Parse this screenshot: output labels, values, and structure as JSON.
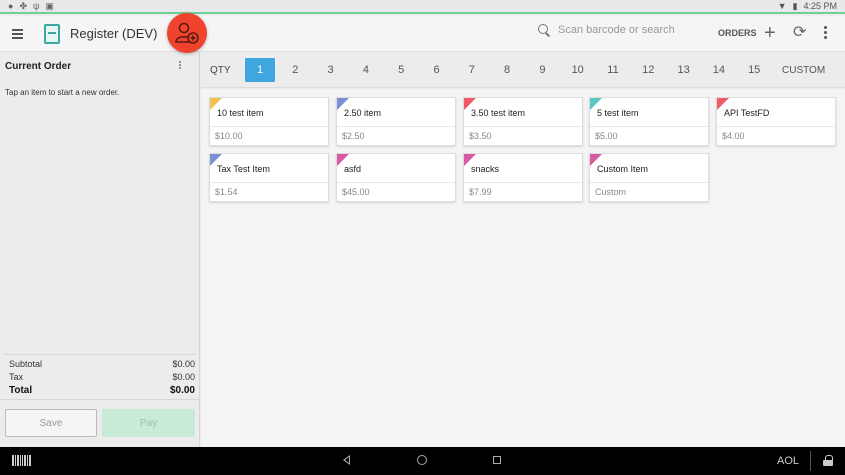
{
  "status_bar": {
    "time": "4:25 PM",
    "left_icons": [
      "circle-icon",
      "fan-icon",
      "usb-icon",
      "square-icon"
    ],
    "right_icons": [
      "wifi-icon",
      "battery-icon"
    ]
  },
  "app_bar": {
    "title": "Register (DEV)",
    "search_placeholder": "Scan barcode or search",
    "orders_label": "ORDERS"
  },
  "current_order": {
    "title": "Current Order",
    "hint": "Tap an item to start a new order.",
    "subtotal_label": "Subtotal",
    "subtotal_value": "$0.00",
    "tax_label": "Tax",
    "tax_value": "$0.00",
    "total_label": "Total",
    "total_value": "$0.00",
    "save_label": "Save",
    "pay_label": "Pay"
  },
  "qty_bar": {
    "label": "QTY",
    "numbers": [
      "1",
      "2",
      "3",
      "4",
      "5",
      "6",
      "7",
      "8",
      "9",
      "10",
      "11",
      "12",
      "13",
      "14",
      "15"
    ],
    "active": "1",
    "custom_label": "CUSTOM"
  },
  "items": [
    {
      "name": "10 test item",
      "price": "$10.00",
      "color": "#f2c14e"
    },
    {
      "name": "2.50 item",
      "price": "$2.50",
      "color": "#7e8fd6"
    },
    {
      "name": "3.50 test item",
      "price": "$3.50",
      "color": "#ef5b67"
    },
    {
      "name": "5 test item",
      "price": "$5.00",
      "color": "#5bc7c4"
    },
    {
      "name": "API TestFD",
      "price": "$4.00",
      "color": "#ef5b67"
    },
    {
      "name": "Tax Test Item",
      "price": "$1.54",
      "color": "#7e8fd6"
    },
    {
      "name": "asfd",
      "price": "$45.00",
      "color": "#d65ba0"
    },
    {
      "name": "snacks",
      "price": "$7.99",
      "color": "#d65ba0"
    },
    {
      "name": "Custom Item",
      "price": "Custom",
      "color": "#d65ba0"
    }
  ],
  "nav_bar": {
    "aol_label": "AOL"
  }
}
